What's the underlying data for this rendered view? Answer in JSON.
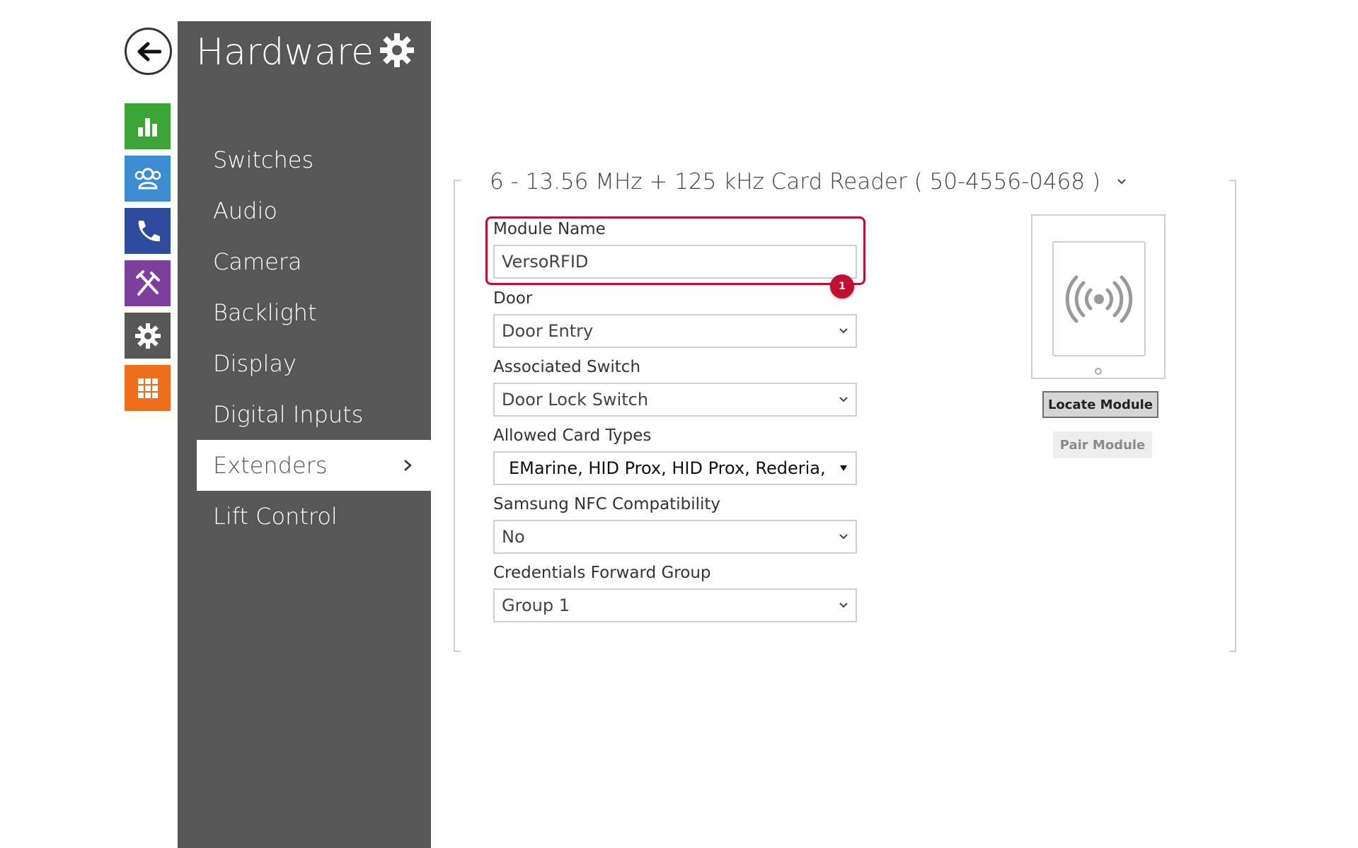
{
  "sidebar": {
    "title": "Hardware",
    "items": [
      {
        "label": "Switches"
      },
      {
        "label": "Audio"
      },
      {
        "label": "Camera"
      },
      {
        "label": "Backlight"
      },
      {
        "label": "Display"
      },
      {
        "label": "Digital Inputs"
      },
      {
        "label": "Extenders",
        "active": true
      },
      {
        "label": "Lift Control"
      }
    ]
  },
  "icon_rail": [
    {
      "icon": "status-chart-icon",
      "color": "#3aa534"
    },
    {
      "icon": "directory-users-icon",
      "color": "#3e8cd1"
    },
    {
      "icon": "phone-icon",
      "color": "#2f4b9e"
    },
    {
      "icon": "services-tools-icon",
      "color": "#7e3f9c"
    },
    {
      "icon": "hardware-gear-icon",
      "color": "#575757"
    },
    {
      "icon": "system-grid-icon",
      "color": "#ee6e1b"
    }
  ],
  "module": {
    "title": "6 - 13.56 MHz + 125 kHz Card Reader ( 50-4556-0468 )",
    "fields": {
      "module_name": {
        "label": "Module Name",
        "value": "VersoRFID"
      },
      "door": {
        "label": "Door",
        "value": "Door Entry"
      },
      "associated_switch": {
        "label": "Associated Switch",
        "value": "Door Lock Switch"
      },
      "allowed_card_types": {
        "label": "Allowed Card Types",
        "value": "EMarine, HID Prox, HID Prox, Rederia, H"
      },
      "samsung_nfc": {
        "label": "Samsung NFC Compatibility",
        "value": "No"
      },
      "credentials_forward_group": {
        "label": "Credentials Forward Group",
        "value": "Group 1"
      }
    },
    "callout_number": "1",
    "buttons": {
      "locate": "Locate Module",
      "pair": "Pair Module"
    }
  },
  "colors": {
    "sidebar_bg": "#575757",
    "highlight": "#c20f2f"
  }
}
